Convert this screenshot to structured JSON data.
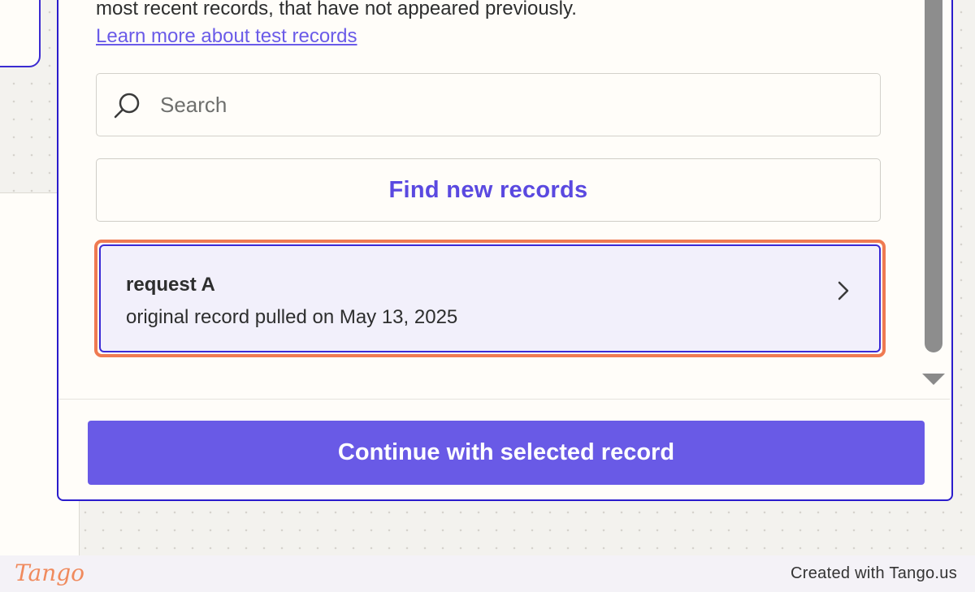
{
  "dialog": {
    "intro_text": "most recent records, that have not appeared previously.",
    "learn_more_link": "Learn more about test records",
    "search": {
      "value": "",
      "placeholder": "Search"
    },
    "find_button_label": "Find new records",
    "records": [
      {
        "title": "request A",
        "subtitle": "original record pulled on May 13, 2025",
        "selected": true
      }
    ],
    "continue_button_label": "Continue with selected record"
  },
  "footer": {
    "logo_text": "Tango",
    "credit_text": "Created with Tango.us"
  },
  "colors": {
    "accent": "#695ae6",
    "link": "#6a5be8",
    "selection_outline": "#ef7a52",
    "modal_border": "#2a1ccc",
    "logo": "#f08a5d"
  },
  "icons": {
    "search": "search-icon",
    "chevron": "chevron-right-icon"
  }
}
